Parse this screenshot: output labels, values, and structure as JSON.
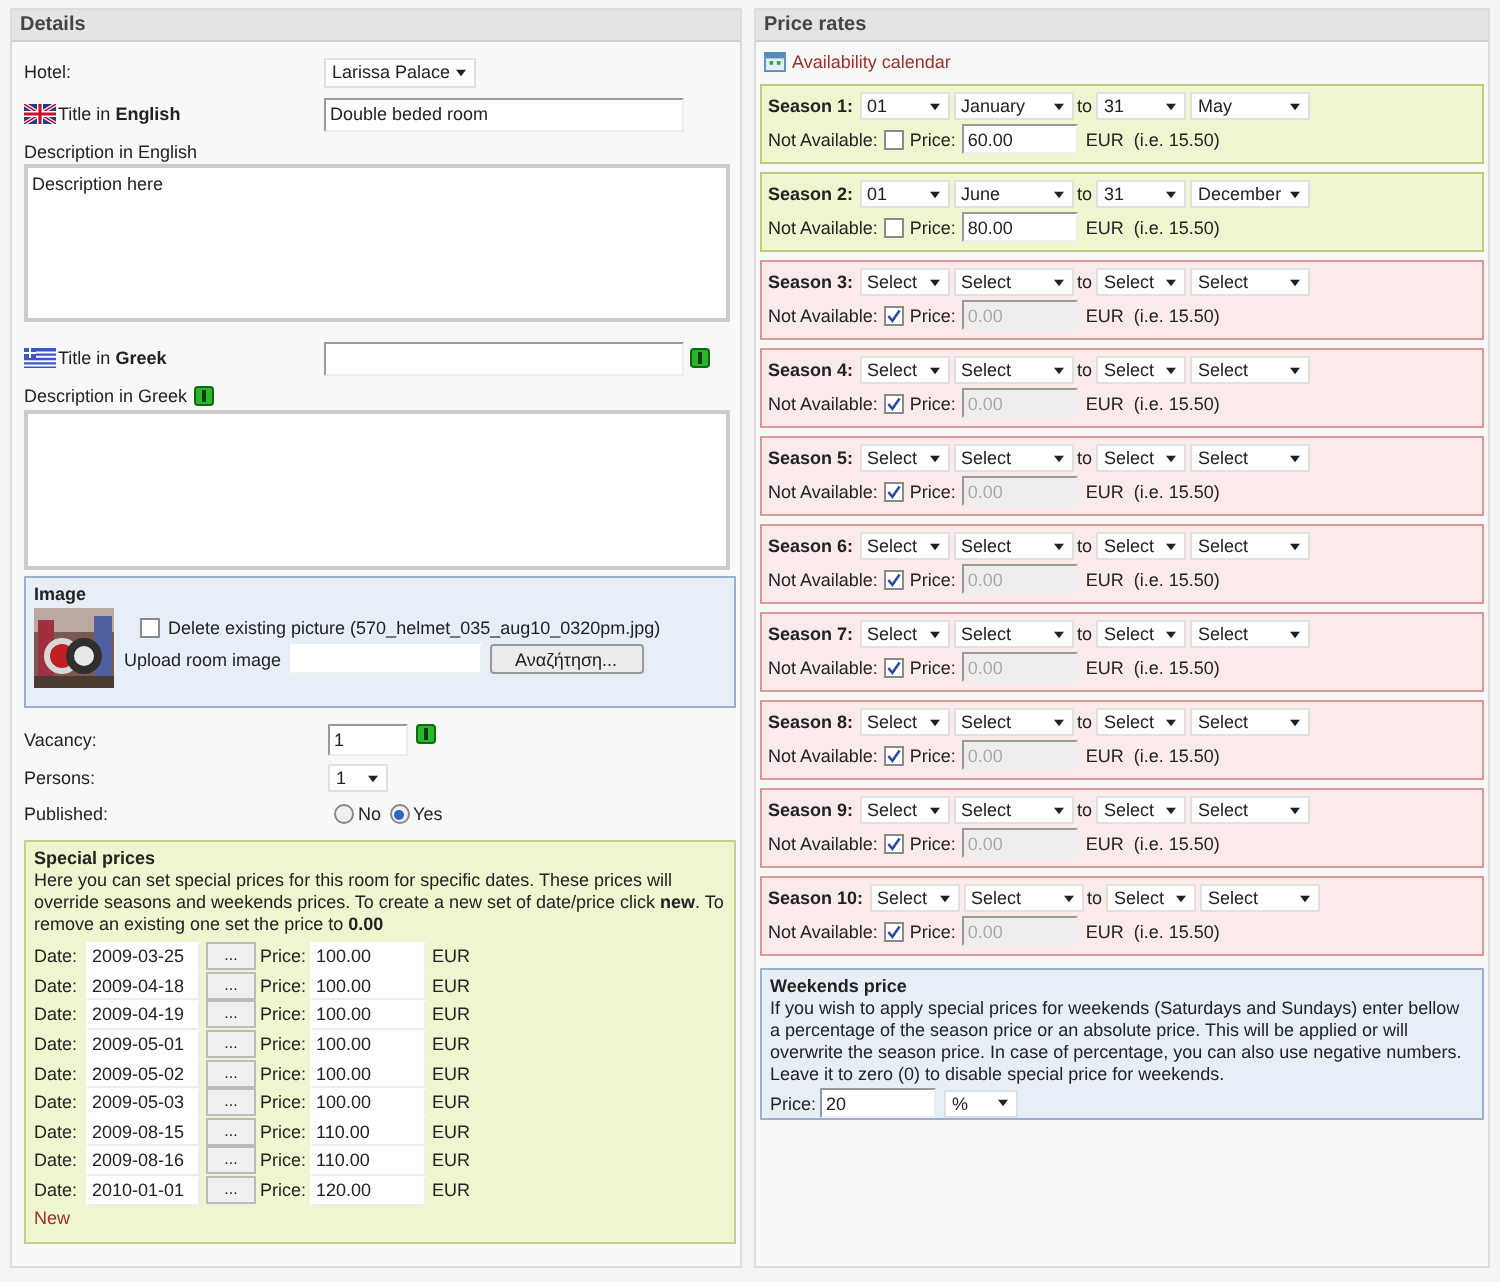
{
  "details": {
    "title": "Details",
    "hotel": {
      "label": "Hotel:",
      "value": "Larissa Palace"
    },
    "title_english": {
      "label": "Title in **English**",
      "value": "Double beded room"
    },
    "description_english": {
      "label": "Description in English",
      "value": "Description here"
    },
    "title_greek": {
      "label": "Title in **Greek**"
    },
    "description_greek": {
      "label": "Description in Greek"
    },
    "image": {
      "title": "Image",
      "delete_label": "Delete existing picture (570_helmet_035_aug10_0320pm.jpg)",
      "delete_checked": false,
      "upload_label": "Upload room image",
      "browse_button": "Αναζήτηση..."
    },
    "vacancy": {
      "label": "Vacancy:",
      "value": "1"
    },
    "persons": {
      "label": "Persons:",
      "value": "1"
    },
    "published": {
      "label": "Published:",
      "options": [
        {
          "label": "No",
          "selected": false
        },
        {
          "label": "Yes",
          "selected": true
        }
      ]
    },
    "special_prices": {
      "title": "Special prices",
      "text": "Here you can set special prices for this room for specific dates. These prices will override seasons and weekends prices. To create a new set of date/price click **new**. To remove an existing one set the price to **0.00**",
      "rows": [
        {
          "date_label": "Date:",
          "date": "2009-03-25",
          "picker": "...",
          "price_label": "Price:",
          "price": "100.00",
          "currency": "EUR"
        },
        {
          "date_label": "Date:",
          "date": "2009-04-18",
          "picker": "...",
          "price_label": "Price:",
          "price": "100.00",
          "currency": "EUR"
        },
        {
          "date_label": "Date:",
          "date": "2009-04-19",
          "picker": "...",
          "price_label": "Price:",
          "price": "100.00",
          "currency": "EUR"
        },
        {
          "date_label": "Date:",
          "date": "2009-05-01",
          "picker": "...",
          "price_label": "Price:",
          "price": "100.00",
          "currency": "EUR"
        },
        {
          "date_label": "Date:",
          "date": "2009-05-02",
          "picker": "...",
          "price_label": "Price:",
          "price": "100.00",
          "currency": "EUR"
        },
        {
          "date_label": "Date:",
          "date": "2009-05-03",
          "picker": "...",
          "price_label": "Price:",
          "price": "100.00",
          "currency": "EUR"
        },
        {
          "date_label": "Date:",
          "date": "2009-08-15",
          "picker": "...",
          "price_label": "Price:",
          "price": "110.00",
          "currency": "EUR"
        },
        {
          "date_label": "Date:",
          "date": "2009-08-16",
          "picker": "...",
          "price_label": "Price:",
          "price": "110.00",
          "currency": "EUR"
        },
        {
          "date_label": "Date:",
          "date": "2010-01-01",
          "picker": "...",
          "price_label": "Price:",
          "price": "120.00",
          "currency": "EUR"
        }
      ],
      "new_link": "New"
    }
  },
  "price_rates": {
    "title": "Price rates",
    "calendar_link": "Availability calendar",
    "seasons": [
      {
        "label": "Season 1:",
        "from_day": "01",
        "from_month": "January",
        "to": "to",
        "to_day": "31",
        "to_month": "May",
        "not_available_label": "Not Available:",
        "not_available": false,
        "price_label": "Price:",
        "price": "60.00",
        "currency": "EUR",
        "hint": "(i.e. 15.50)"
      },
      {
        "label": "Season 2:",
        "from_day": "01",
        "from_month": "June",
        "to": "to",
        "to_day": "31",
        "to_month": "December",
        "not_available_label": "Not Available:",
        "not_available": false,
        "price_label": "Price:",
        "price": "80.00",
        "currency": "EUR",
        "hint": "(i.e. 15.50)"
      },
      {
        "label": "Season 3:",
        "from_day": "Select",
        "from_month": "Select",
        "to": "to",
        "to_day": "Select",
        "to_month": "Select",
        "not_available_label": "Not Available:",
        "not_available": true,
        "price_label": "Price:",
        "price": "0.00",
        "currency": "EUR",
        "hint": "(i.e. 15.50)"
      },
      {
        "label": "Season 4:",
        "from_day": "Select",
        "from_month": "Select",
        "to": "to",
        "to_day": "Select",
        "to_month": "Select",
        "not_available_label": "Not Available:",
        "not_available": true,
        "price_label": "Price:",
        "price": "0.00",
        "currency": "EUR",
        "hint": "(i.e. 15.50)"
      },
      {
        "label": "Season 5:",
        "from_day": "Select",
        "from_month": "Select",
        "to": "to",
        "to_day": "Select",
        "to_month": "Select",
        "not_available_label": "Not Available:",
        "not_available": true,
        "price_label": "Price:",
        "price": "0.00",
        "currency": "EUR",
        "hint": "(i.e. 15.50)"
      },
      {
        "label": "Season 6:",
        "from_day": "Select",
        "from_month": "Select",
        "to": "to",
        "to_day": "Select",
        "to_month": "Select",
        "not_available_label": "Not Available:",
        "not_available": true,
        "price_label": "Price:",
        "price": "0.00",
        "currency": "EUR",
        "hint": "(i.e. 15.50)"
      },
      {
        "label": "Season 7:",
        "from_day": "Select",
        "from_month": "Select",
        "to": "to",
        "to_day": "Select",
        "to_month": "Select",
        "not_available_label": "Not Available:",
        "not_available": true,
        "price_label": "Price:",
        "price": "0.00",
        "currency": "EUR",
        "hint": "(i.e. 15.50)"
      },
      {
        "label": "Season 8:",
        "from_day": "Select",
        "from_month": "Select",
        "to": "to",
        "to_day": "Select",
        "to_month": "Select",
        "not_available_label": "Not Available:",
        "not_available": true,
        "price_label": "Price:",
        "price": "0.00",
        "currency": "EUR",
        "hint": "(i.e. 15.50)"
      },
      {
        "label": "Season 9:",
        "from_day": "Select",
        "from_month": "Select",
        "to": "to",
        "to_day": "Select",
        "to_month": "Select",
        "not_available_label": "Not Available:",
        "not_available": true,
        "price_label": "Price:",
        "price": "0.00",
        "currency": "EUR",
        "hint": "(i.e. 15.50)"
      },
      {
        "label": "Season 10:",
        "from_day": "Select",
        "from_month": "Select",
        "to": "to",
        "to_day": "Select",
        "to_month": "Select",
        "not_available_label": "Not Available:",
        "not_available": true,
        "price_label": "Price:",
        "price": "0.00",
        "currency": "EUR",
        "hint": "(i.e. 15.50)"
      }
    ],
    "weekends": {
      "title": "Weekends price",
      "text": "If you wish to apply special prices for weekends (Saturdays and Sundays) enter bellow a percentage of the season price or an absolute price. This will be applied or will overwrite the season price. In case of percentage, you can also use negative numbers. Leave it to zero (0) to disable special price for weekends.",
      "price_label": "Price:",
      "price": "20",
      "unit": "%"
    }
  }
}
